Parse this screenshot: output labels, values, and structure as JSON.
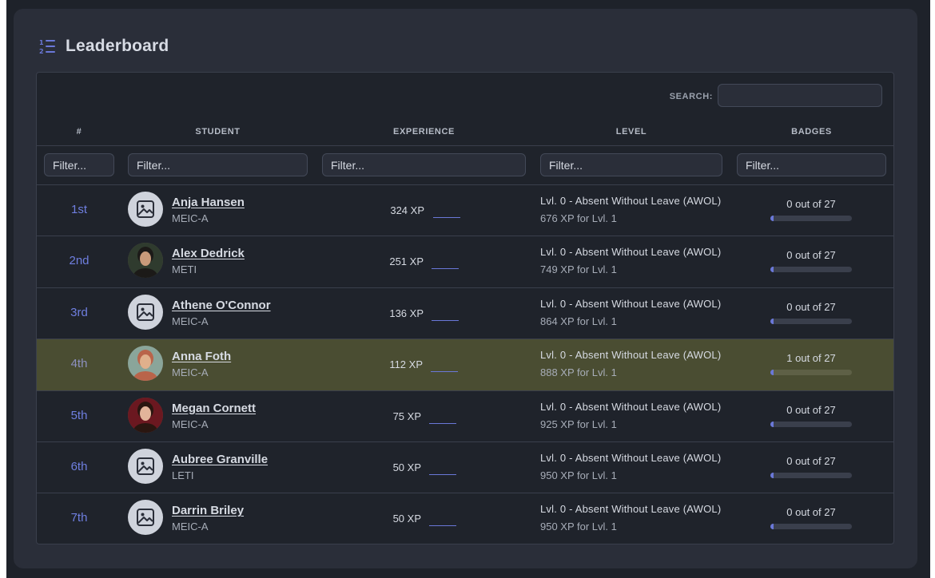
{
  "header": {
    "title": "Leaderboard",
    "icon": "ordered-list-icon"
  },
  "search": {
    "label": "SEARCH:",
    "value": ""
  },
  "columns": {
    "rank": "#",
    "student": "STUDENT",
    "experience": "EXPERIENCE",
    "level": "LEVEL",
    "badges": "BADGES"
  },
  "filters": {
    "rank": "Filter...",
    "student": "Filter...",
    "experience": "Filter...",
    "level": "Filter...",
    "badges": "Filter..."
  },
  "colors": {
    "accent": "#6a78d8",
    "highlight": "#4a4d32",
    "panel": "#2a2e39"
  },
  "rows": [
    {
      "rank": "1st",
      "name": "Anja Hansen",
      "course": "MEIC-A",
      "avatar": "placeholder-image-icon",
      "xp": "324 XP",
      "level": "Lvl. 0 - Absent Without Leave (AWOL)",
      "next": "676 XP for Lvl. 1",
      "badges": "0 out of 27",
      "badge_progress": 0,
      "highlight": false
    },
    {
      "rank": "2nd",
      "name": "Alex Dedrick",
      "course": "METI",
      "avatar": "user-photo",
      "xp": "251 XP",
      "level": "Lvl. 0 - Absent Without Leave (AWOL)",
      "next": "749 XP for Lvl. 1",
      "badges": "0 out of 27",
      "badge_progress": 0,
      "highlight": false
    },
    {
      "rank": "3rd",
      "name": "Athene O'Connor",
      "course": "MEIC-A",
      "avatar": "placeholder-image-icon",
      "xp": "136 XP",
      "level": "Lvl. 0 - Absent Without Leave (AWOL)",
      "next": "864 XP for Lvl. 1",
      "badges": "0 out of 27",
      "badge_progress": 0,
      "highlight": false
    },
    {
      "rank": "4th",
      "name": "Anna Foth",
      "course": "MEIC-A",
      "avatar": "user-photo",
      "xp": "112 XP",
      "level": "Lvl. 0 - Absent Without Leave (AWOL)",
      "next": "888 XP for Lvl. 1",
      "badges": "1 out of 27",
      "badge_progress": 0.037,
      "highlight": true
    },
    {
      "rank": "5th",
      "name": "Megan Cornett",
      "course": "MEIC-A",
      "avatar": "user-photo",
      "xp": "75 XP",
      "level": "Lvl. 0 - Absent Without Leave (AWOL)",
      "next": "925 XP for Lvl. 1",
      "badges": "0 out of 27",
      "badge_progress": 0,
      "highlight": false
    },
    {
      "rank": "6th",
      "name": "Aubree Granville",
      "course": "LETI",
      "avatar": "placeholder-image-icon",
      "xp": "50 XP",
      "level": "Lvl. 0 - Absent Without Leave (AWOL)",
      "next": "950 XP for Lvl. 1",
      "badges": "0 out of 27",
      "badge_progress": 0,
      "highlight": false
    },
    {
      "rank": "7th",
      "name": "Darrin Briley",
      "course": "MEIC-A",
      "avatar": "placeholder-image-icon",
      "xp": "50 XP",
      "level": "Lvl. 0 - Absent Without Leave (AWOL)",
      "next": "950 XP for Lvl. 1",
      "badges": "0 out of 27",
      "badge_progress": 0,
      "highlight": false
    }
  ]
}
